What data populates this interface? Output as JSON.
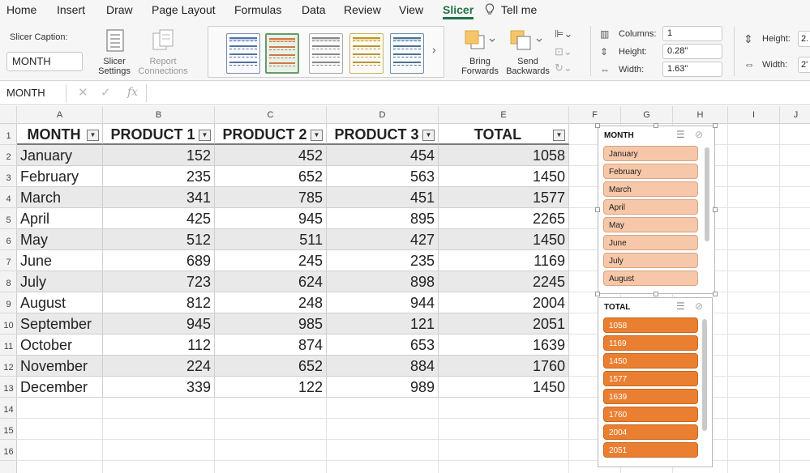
{
  "tabs": [
    "Home",
    "Insert",
    "Draw",
    "Page Layout",
    "Formulas",
    "Data",
    "Review",
    "View",
    "Slicer",
    "Tell me"
  ],
  "active_tab": "Slicer",
  "ribbon": {
    "slicer_caption_label": "Slicer Caption:",
    "slicer_caption_value": "MONTH",
    "slicer_settings_l1": "Slicer",
    "slicer_settings_l2": "Settings",
    "report_conn_l1": "Report",
    "report_conn_l2": "Connections",
    "bring_l1": "Bring",
    "bring_l2": "Forwards",
    "send_l1": "Send",
    "send_l2": "Backwards",
    "columns_label": "Columns:",
    "columns_value": "1",
    "height_label": "Height:",
    "height_value": "0.28\"",
    "width_label": "Width:",
    "width_value": "1.63\"",
    "shape_height_label": "Height:",
    "shape_height_value": "2.",
    "shape_width_label": "Width:",
    "shape_width_value": "2'"
  },
  "formula_bar": {
    "name_box": "MONTH",
    "fx": "fx",
    "value": ""
  },
  "col_headers": [
    "A",
    "B",
    "C",
    "D",
    "E",
    "F",
    "G",
    "H",
    "I",
    "J"
  ],
  "row_headers": [
    "1",
    "2",
    "3",
    "4",
    "5",
    "6",
    "7",
    "8",
    "9",
    "10",
    "11",
    "12",
    "13",
    "14",
    "15",
    "16"
  ],
  "table": {
    "headers": [
      "MONTH",
      "PRODUCT 1",
      "PRODUCT 2",
      "PRODUCT 3",
      "TOTAL"
    ],
    "rows": [
      [
        "January",
        "152",
        "452",
        "454",
        "1058"
      ],
      [
        "February",
        "235",
        "652",
        "563",
        "1450"
      ],
      [
        "March",
        "341",
        "785",
        "451",
        "1577"
      ],
      [
        "April",
        "425",
        "945",
        "895",
        "2265"
      ],
      [
        "May",
        "512",
        "511",
        "427",
        "1450"
      ],
      [
        "June",
        "689",
        "245",
        "235",
        "1169"
      ],
      [
        "July",
        "723",
        "624",
        "898",
        "2245"
      ],
      [
        "August",
        "812",
        "248",
        "944",
        "2004"
      ],
      [
        "September",
        "945",
        "985",
        "121",
        "2051"
      ],
      [
        "October",
        "112",
        "874",
        "653",
        "1639"
      ],
      [
        "November",
        "224",
        "652",
        "884",
        "1760"
      ],
      [
        "December",
        "339",
        "122",
        "989",
        "1450"
      ]
    ]
  },
  "slicers": {
    "month": {
      "title": "MONTH",
      "items": [
        "January",
        "February",
        "March",
        "April",
        "May",
        "June",
        "July",
        "August"
      ]
    },
    "total": {
      "title": "TOTAL",
      "items": [
        "1058",
        "1169",
        "1450",
        "1577",
        "1639",
        "1760",
        "2004",
        "2051"
      ]
    }
  },
  "colors": {
    "accent": "#217346",
    "month_item": "#f6c7a8",
    "total_item": "#ea7f31",
    "band": "#e9e9e9"
  }
}
